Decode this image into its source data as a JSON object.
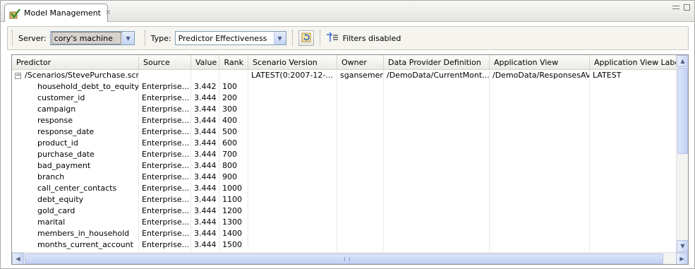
{
  "tab": {
    "title": "Model Management",
    "close_glyph": "✕"
  },
  "toolbar": {
    "server_label": "Server:",
    "server_value": "cory's machine",
    "type_label": "Type:",
    "type_value": "Predictor Effectiveness",
    "filters_label": "Filters disabled"
  },
  "table": {
    "columns": [
      "Predictor",
      "Source",
      "Value",
      "Rank",
      "Scenario Version",
      "Owner",
      "Data Provider Definition",
      "Application View",
      "Application View Label"
    ],
    "parent": {
      "predictor": "/Scenarios/StevePurchase.scn",
      "source": "",
      "value": "",
      "rank": "",
      "scenario_version": "LATEST(0:2007-12-...",
      "owner": "sgansemer",
      "data_provider": "/DemoData/CurrentMont...",
      "app_view": "/DemoData/ResponsesAV",
      "app_view_label": "LATEST"
    },
    "rows": [
      {
        "predictor": "household_debt_to_equity_",
        "source": "Enterprise...",
        "value": "3.442",
        "rank": "100"
      },
      {
        "predictor": "customer_id",
        "source": "Enterprise...",
        "value": "3.444",
        "rank": "200"
      },
      {
        "predictor": "campaign",
        "source": "Enterprise...",
        "value": "3.444",
        "rank": "300"
      },
      {
        "predictor": "response",
        "source": "Enterprise...",
        "value": "3.444",
        "rank": "400"
      },
      {
        "predictor": "response_date",
        "source": "Enterprise...",
        "value": "3.444",
        "rank": "500"
      },
      {
        "predictor": "product_id",
        "source": "Enterprise...",
        "value": "3.444",
        "rank": "600"
      },
      {
        "predictor": "purchase_date",
        "source": "Enterprise...",
        "value": "3.444",
        "rank": "700"
      },
      {
        "predictor": "bad_payment",
        "source": "Enterprise...",
        "value": "3.444",
        "rank": "800"
      },
      {
        "predictor": "branch",
        "source": "Enterprise...",
        "value": "3.444",
        "rank": "900"
      },
      {
        "predictor": "call_center_contacts",
        "source": "Enterprise...",
        "value": "3.444",
        "rank": "1000"
      },
      {
        "predictor": "debt_equity",
        "source": "Enterprise...",
        "value": "3.444",
        "rank": "1100"
      },
      {
        "predictor": "gold_card",
        "source": "Enterprise...",
        "value": "3.444",
        "rank": "1200"
      },
      {
        "predictor": "marital",
        "source": "Enterprise...",
        "value": "3.444",
        "rank": "1300"
      },
      {
        "predictor": "members_in_household",
        "source": "Enterprise...",
        "value": "3.444",
        "rank": "1400"
      },
      {
        "predictor": "months_current_account",
        "source": "Enterprise...",
        "value": "3.444",
        "rank": "1500"
      }
    ]
  },
  "icons": {
    "tab": "model-check-icon",
    "refresh": "refresh-icon",
    "filter": "filter-icon"
  }
}
